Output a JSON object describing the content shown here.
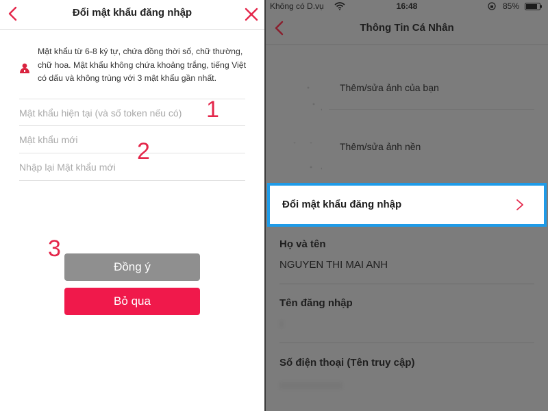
{
  "left": {
    "title": "Đổi mật khẩu đăng nhập",
    "notice_icon": "user-lock-icon",
    "notice_text": "Mật khẩu từ 6-8 ký tự, chứa đồng thời số, chữ thường, chữ hoa. Mật khẩu không chứa khoảng trắng, tiếng Việt có dấu và không trùng với 3 mật khẩu gần nhất.",
    "fields": {
      "current_placeholder": "Mật khẩu hiện tại (và số token nếu có)",
      "new_placeholder": "Mật khẩu mới",
      "confirm_placeholder": "Nhập lại Mật khẩu mới"
    },
    "step_markers": [
      "1",
      "2",
      "3"
    ],
    "buttons": {
      "agree": "Đồng ý",
      "skip": "Bỏ qua"
    },
    "colors": {
      "accent": "#e4264a",
      "skip_button": "#f0194b",
      "agree_button": "#8f8f8f"
    }
  },
  "right": {
    "status_bar": {
      "carrier": "Không có D.vụ",
      "time": "16:48",
      "battery": "85%"
    },
    "title": "Thông Tin Cá Nhân",
    "rows": {
      "avatar": "Thêm/sửa ảnh của bạn",
      "cover": "Thêm/sửa ảnh nền"
    },
    "highlighted_item": "Đổi mật khẩu đăng nhập",
    "info": {
      "fullname_label": "Họ và tên",
      "fullname_value": "NGUYEN THI MAI ANH",
      "username_label": "Tên đăng nhập",
      "phone_label": "Số điện thoại (Tên truy cập)"
    },
    "colors": {
      "highlight_border": "#1e9be8",
      "overlay": "#7c7c7c"
    }
  }
}
